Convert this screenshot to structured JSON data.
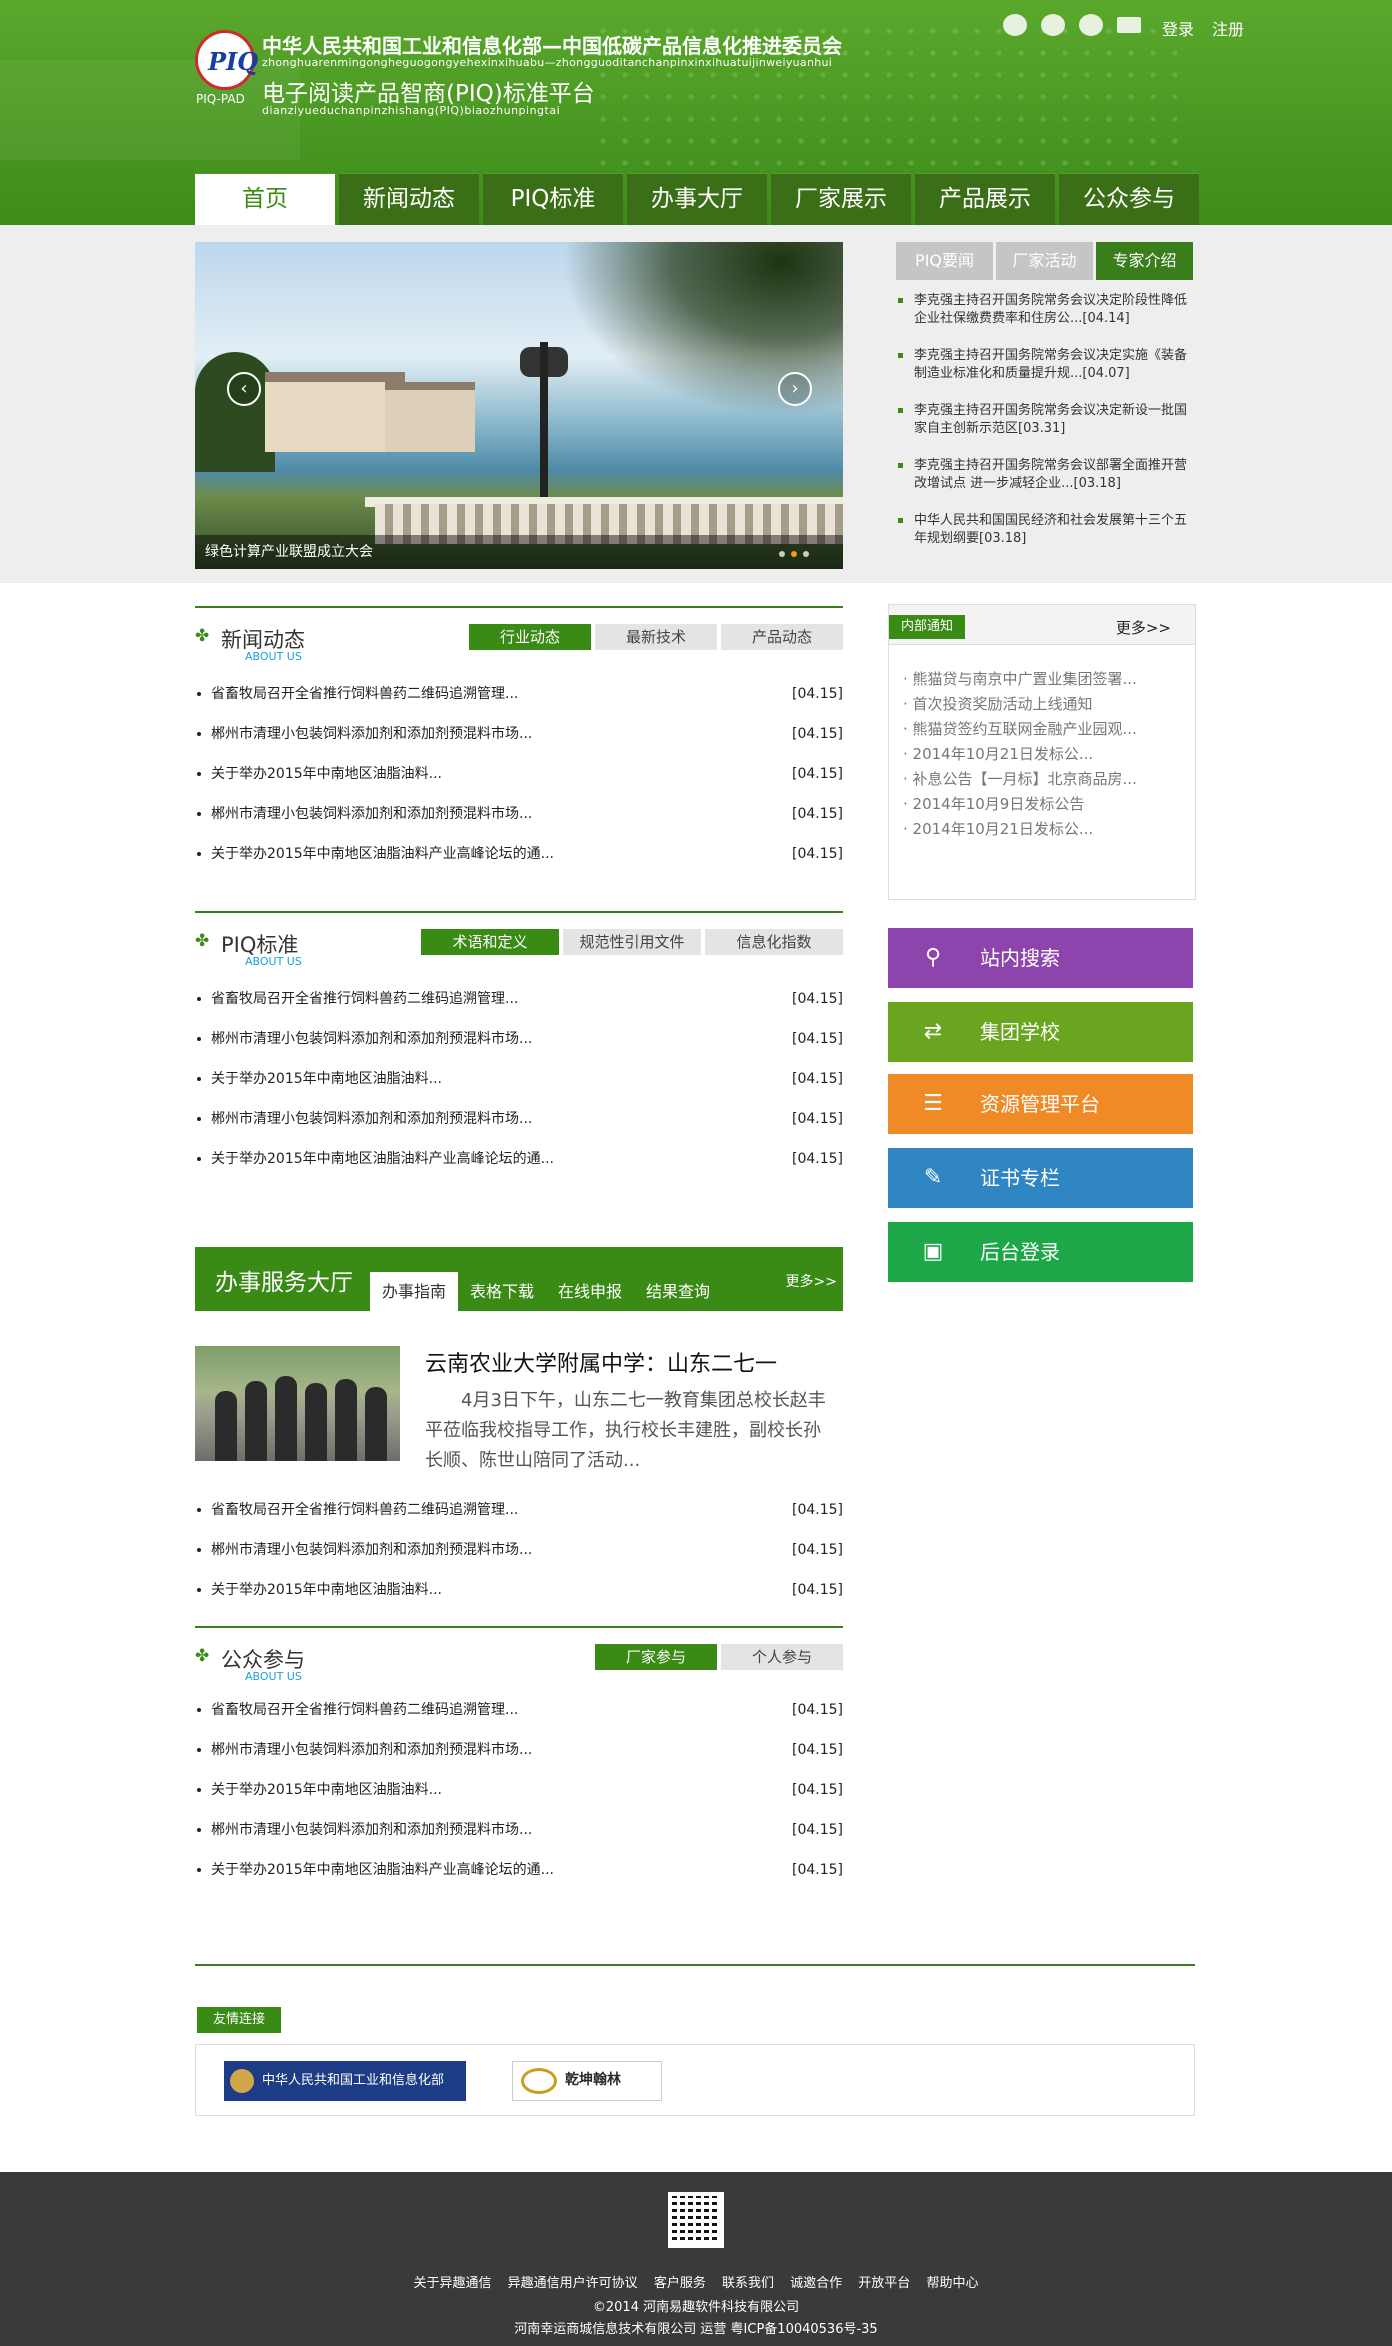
{
  "header": {
    "logo_text": "PIQ",
    "logo_caption": "PIQ-PAD",
    "title": "中华人民共和国工业和信息化部—中国低碳产品信息化推进委员会",
    "pinyin": "zhonghuarenmingongheguogongyehexinxihuabu—zhongguoditanchanpinxinxihuatuijinweiyuanhui",
    "title2": "电子阅读产品智商(PIQ)标准平台",
    "pinyin2": "dianziyueduchanpinzhishang(PIQ)biaozhunpingtai",
    "login": "登录",
    "register": "注册",
    "icons": [
      "qq-icon",
      "weibo-icon",
      "wechat-icon",
      "mail-icon"
    ]
  },
  "nav": [
    "首页",
    "新闻动态",
    "PIQ标准",
    "办事大厅",
    "厂家展示",
    "产品展示",
    "公众参与"
  ],
  "banner": {
    "caption": "绿色计算产业联盟成立大会",
    "prev": "‹",
    "next": "›"
  },
  "news_tabs": [
    "PIQ要闻",
    "厂家活动",
    "专家介绍"
  ],
  "news_items": [
    "李克强主持召开国务院常务会议决定阶段性降低企业社保缴费费率和住房公...[04.14]",
    "李克强主持召开国务院常务会议决定实施《装备制造业标准化和质量提升规...[04.07]",
    "李克强主持召开国务院常务会议决定新设一批国家自主创新示范区[03.31]",
    "李克强主持召开国务院常务会议部署全面推开营改增试点 进一步减轻企业...[03.18]",
    "中华人民共和国国民经济和社会发展第十三个五年规划纲要[03.18]"
  ],
  "section_news": {
    "title": "新闻动态",
    "sub": "ABOUT US",
    "tabs": [
      "行业动态",
      "最新技术",
      "产品动态"
    ],
    "items": [
      {
        "t": "省畜牧局召开全省推行饲料兽药二维码追溯管理...",
        "d": "[04.15]"
      },
      {
        "t": "郴州市清理小包装饲料添加剂和添加剂预混料市场...",
        "d": "[04.15]"
      },
      {
        "t": "关于举办2015年中南地区油脂油料...",
        "d": "[04.15]"
      },
      {
        "t": "郴州市清理小包装饲料添加剂和添加剂预混料市场...",
        "d": "[04.15]"
      },
      {
        "t": "关于举办2015年中南地区油脂油料产业高峰论坛的通...",
        "d": "[04.15]"
      }
    ]
  },
  "section_piq": {
    "title": "PIQ标准",
    "sub": "ABOUT US",
    "tabs": [
      "术语和定义",
      "规范性引用文件",
      "信息化指数"
    ],
    "items": [
      {
        "t": "省畜牧局召开全省推行饲料兽药二维码追溯管理...",
        "d": "[04.15]"
      },
      {
        "t": "郴州市清理小包装饲料添加剂和添加剂预混料市场...",
        "d": "[04.15]"
      },
      {
        "t": "关于举办2015年中南地区油脂油料...",
        "d": "[04.15]"
      },
      {
        "t": "郴州市清理小包装饲料添加剂和添加剂预混料市场...",
        "d": "[04.15]"
      },
      {
        "t": "关于举办2015年中南地区油脂油料产业高峰论坛的通...",
        "d": "[04.15]"
      }
    ]
  },
  "section_service": {
    "title": "办事服务大厅",
    "tabs": [
      "办事指南",
      "表格下载",
      "在线申报",
      "结果查询"
    ],
    "more": "更多>>",
    "feature_title": "云南农业大学附属中学：山东二七一",
    "feature_text": "4月3日下午，山东二七一教育集团总校长赵丰平莅临我校指导工作，执行校长丰建胜，副校长孙长顺、陈世山陪同了活动...",
    "items": [
      {
        "t": "省畜牧局召开全省推行饲料兽药二维码追溯管理...",
        "d": "[04.15]"
      },
      {
        "t": "郴州市清理小包装饲料添加剂和添加剂预混料市场...",
        "d": "[04.15]"
      },
      {
        "t": "关于举办2015年中南地区油脂油料...",
        "d": "[04.15]"
      }
    ]
  },
  "section_public": {
    "title": "公众参与",
    "sub": "ABOUT US",
    "tabs": [
      "厂家参与",
      "个人参与"
    ],
    "items": [
      {
        "t": "省畜牧局召开全省推行饲料兽药二维码追溯管理...",
        "d": "[04.15]"
      },
      {
        "t": "郴州市清理小包装饲料添加剂和添加剂预混料市场...",
        "d": "[04.15]"
      },
      {
        "t": "关于举办2015年中南地区油脂油料...",
        "d": "[04.15]"
      },
      {
        "t": "郴州市清理小包装饲料添加剂和添加剂预混料市场...",
        "d": "[04.15]"
      },
      {
        "t": "关于举办2015年中南地区油脂油料产业高峰论坛的通...",
        "d": "[04.15]"
      }
    ]
  },
  "notice": {
    "label": "内部通知",
    "more": "更多>>",
    "items": [
      "· 熊猫贷与南京中广置业集团签署...",
      "· 首次投资奖励活动上线通知",
      "· 熊猫贷签约互联网金融产业园观...",
      "· 2014年10月21日发标公...",
      "· 补息公告【一月标】北京商品房...",
      "· 2014年10月9日发标公告",
      "· 2014年10月21日发标公..."
    ]
  },
  "quick": [
    {
      "label": "站内搜索",
      "color": "#8e44ad",
      "icon": "search-icon"
    },
    {
      "label": "集团学校",
      "color": "#6aa51f",
      "icon": "refresh-icon"
    },
    {
      "label": "资源管理平台",
      "color": "#ef8a27",
      "icon": "layers-icon"
    },
    {
      "label": "证书专栏",
      "color": "#2f86c3",
      "icon": "certificate-icon"
    },
    {
      "label": "后台登录",
      "color": "#1da749",
      "icon": "monitor-icon"
    }
  ],
  "links": {
    "label": "友情连接",
    "logo1": "中华人民共和国工业和信息化部",
    "logo2": "乾坤翰林"
  },
  "footer": {
    "links": [
      "关于异趣通信",
      "异趣通信用户许可协议",
      "客户服务",
      "联系我们",
      "诚邀合作",
      "开放平台",
      "帮助中心"
    ],
    "copyright": "©2014 河南易趣软件科技有限公司",
    "icp": "河南幸运商城信息技术有限公司 运营 粤ICP备10040536号-35"
  }
}
